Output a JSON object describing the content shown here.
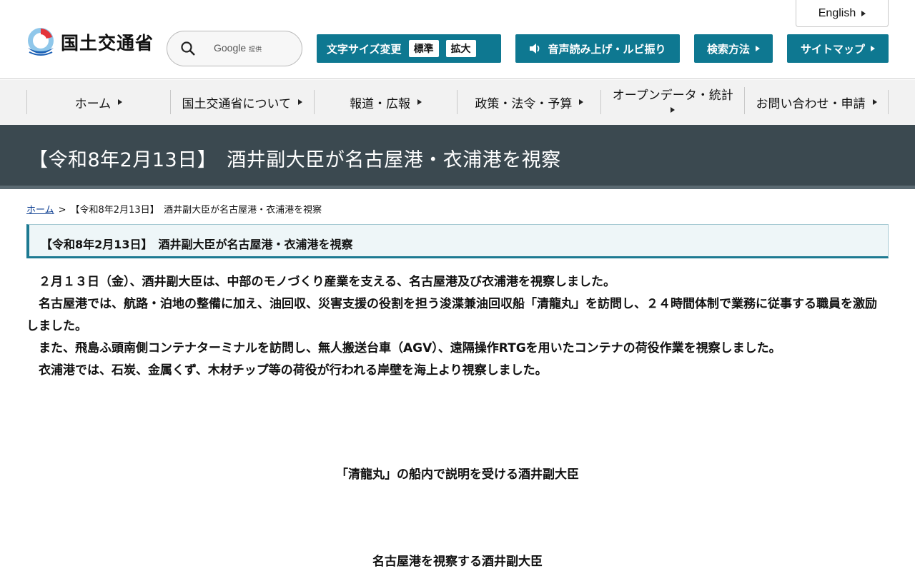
{
  "header": {
    "logo_text": "国土交通省",
    "search_placeholder": "Google",
    "search_provided": "提供",
    "english_label": "English",
    "font_size_label": "文字サイズ変更",
    "font_size_standard": "標準",
    "font_size_large": "拡大",
    "audio_label": "音声読み上げ・ルビ振り",
    "search_method_label": "検索方法",
    "sitemap_label": "サイトマップ"
  },
  "nav": {
    "items": [
      {
        "label": "ホーム"
      },
      {
        "label": "国土交通省について"
      },
      {
        "label": "報道・広報"
      },
      {
        "label": "政策・法令・予算"
      },
      {
        "label": "オープンデータ・統計"
      },
      {
        "label": "お問い合わせ・申請"
      }
    ]
  },
  "page": {
    "title": "【令和8年2月13日】　酒井副大臣が名古屋港・衣浦港を視察",
    "breadcrumb_home": "ホーム",
    "breadcrumb_sep": ">",
    "breadcrumb_current": "【令和8年2月13日】　酒井副大臣が名古屋港・衣浦港を視察",
    "heading": "【令和8年2月13日】　酒井副大臣が名古屋港・衣浦港を視察",
    "paragraphs": [
      "　２月１３日（金）、酒井副大臣は、中部のモノづくり産業を支える、名古屋港及び衣浦港を視察しました。",
      "　名古屋港では、航路・泊地の整備に加え、油回収、災害支援の役割を担う浚渫兼油回収船「清龍丸」を訪問し、２４時間体制で業務に従事する職員を激励しました。",
      "　また、飛島ふ頭南側コンテナターミナルを訪問し、無人搬送台車（AGV）、遠隔操作RTGを用いたコンテナの荷役作業を視察しました。",
      "　衣浦港では、石炭、金属くず、木材チップ等の荷役が行われる岸壁を海上より視察しました。"
    ],
    "caption1": "「清龍丸」の船内で説明を受ける酒井副大臣",
    "caption2": "名古屋港を視察する酒井副大臣"
  },
  "colors": {
    "accent": "#0e7891",
    "banner": "#3b4950",
    "nav_bg": "#f2f2f2",
    "heading_bg": "#eef6f8"
  }
}
